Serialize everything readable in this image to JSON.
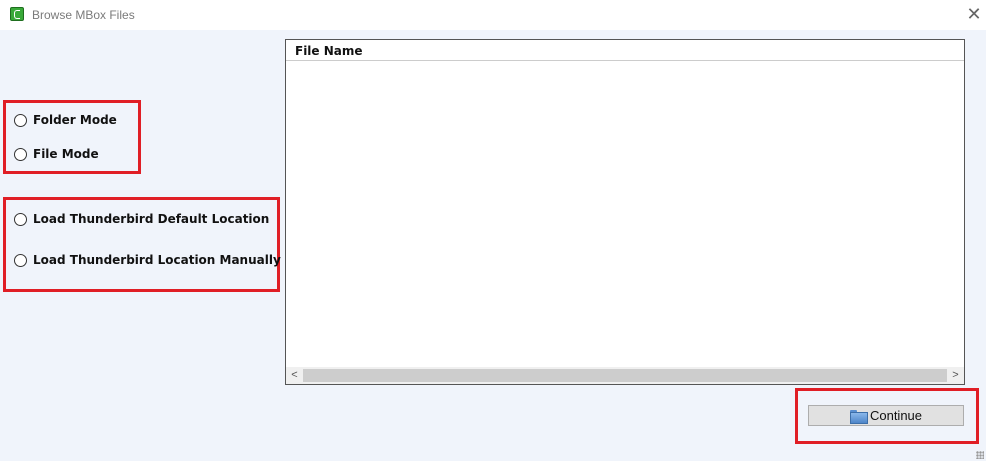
{
  "window": {
    "title": "Browse MBox Files",
    "close_glyph": "✕"
  },
  "options": {
    "mode": [
      {
        "label": "Folder Mode",
        "selected": false
      },
      {
        "label": "File Mode",
        "selected": false
      }
    ],
    "location": [
      {
        "label": "Load Thunderbird Default Location",
        "selected": false
      },
      {
        "label": "Load Thunderbird Location Manually",
        "selected": false
      }
    ]
  },
  "file_list": {
    "column_header": "File Name",
    "rows": [],
    "scroll_left_glyph": "<",
    "scroll_right_glyph": ">"
  },
  "actions": {
    "continue_label": "Continue",
    "continue_icon": "folder-icon"
  },
  "colors": {
    "highlight": "#e01e25",
    "background": "#f0f4fb"
  }
}
